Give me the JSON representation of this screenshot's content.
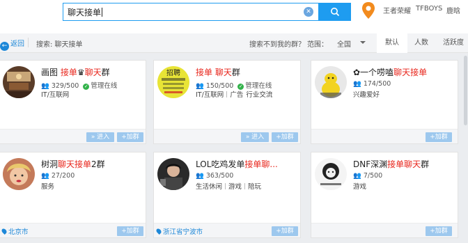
{
  "search": {
    "value": "聊天接单",
    "clear_icon": "clear-icon",
    "button_icon": "search-icon"
  },
  "hot_links": [
    "王者荣耀",
    "TFBOYS",
    "鹿晗"
  ],
  "filter": {
    "back": "返回",
    "search_label": "搜索: 聊天接单",
    "not_found": "搜索不到我的群？",
    "range_label": "范围：",
    "range_value": "全国",
    "tabs": [
      "默认",
      "人数",
      "活跃度"
    ],
    "active_tab": "默认"
  },
  "cards": [
    {
      "title": [
        {
          "t": "画图 ",
          "hl": false
        },
        {
          "t": "接单",
          "hl": true
        },
        {
          "t": "♛",
          "hl": false
        },
        {
          "t": "聊天",
          "hl": true
        },
        {
          "t": "群",
          "hl": false
        }
      ],
      "members": "329/500",
      "manager": "管理在线",
      "tags": [
        "IT/互联网"
      ],
      "location": "",
      "buttons": {
        "enter": "» 进入",
        "join": "+加群"
      }
    },
    {
      "title": [
        {
          "t": "接单 ",
          "hl": true
        },
        {
          "t": "聊天",
          "hl": true
        },
        {
          "t": "群",
          "hl": false
        }
      ],
      "members": "150/500",
      "manager": "管理在线",
      "tags": [
        "IT/互联网",
        "广告",
        "行业交流"
      ],
      "location": "",
      "buttons": {
        "enter": "» 进入",
        "join": "+加群"
      },
      "avatar_text": "招聘"
    },
    {
      "title": [
        {
          "t": "✿一个唠嗑",
          "hl": false
        },
        {
          "t": "聊天接单",
          "hl": true
        }
      ],
      "members": "174/500",
      "manager": "",
      "tags": [
        "兴趣爱好"
      ],
      "location": "",
      "buttons": {
        "enter": "",
        "join": "+加群"
      }
    },
    {
      "title": [
        {
          "t": "树洞",
          "hl": false
        },
        {
          "t": "聊天接单",
          "hl": true
        },
        {
          "t": "2群",
          "hl": false
        }
      ],
      "members": "27/200",
      "manager": "",
      "tags": [
        "服务"
      ],
      "location": "北京市",
      "buttons": {
        "enter": "",
        "join": "+加群"
      }
    },
    {
      "title": [
        {
          "t": "LOL吃鸡发单",
          "hl": false
        },
        {
          "t": "接单聊...",
          "hl": true
        }
      ],
      "members": "363/500",
      "manager": "",
      "tags": [
        "生活休闲",
        "游戏",
        "陪玩"
      ],
      "location": "浙江省宁波市",
      "buttons": {
        "enter": "",
        "join": "+加群"
      }
    },
    {
      "title": [
        {
          "t": "DNF深渊",
          "hl": false
        },
        {
          "t": "接单聊天",
          "hl": true
        },
        {
          "t": "群",
          "hl": false
        }
      ],
      "members": "7/500",
      "manager": "",
      "tags": [
        "游戏"
      ],
      "location": "",
      "buttons": {
        "enter": "",
        "join": "+加群"
      }
    }
  ],
  "colors": {
    "accent": "#1e9cf0",
    "highlight": "#e8261c",
    "online": "#32b24a"
  }
}
